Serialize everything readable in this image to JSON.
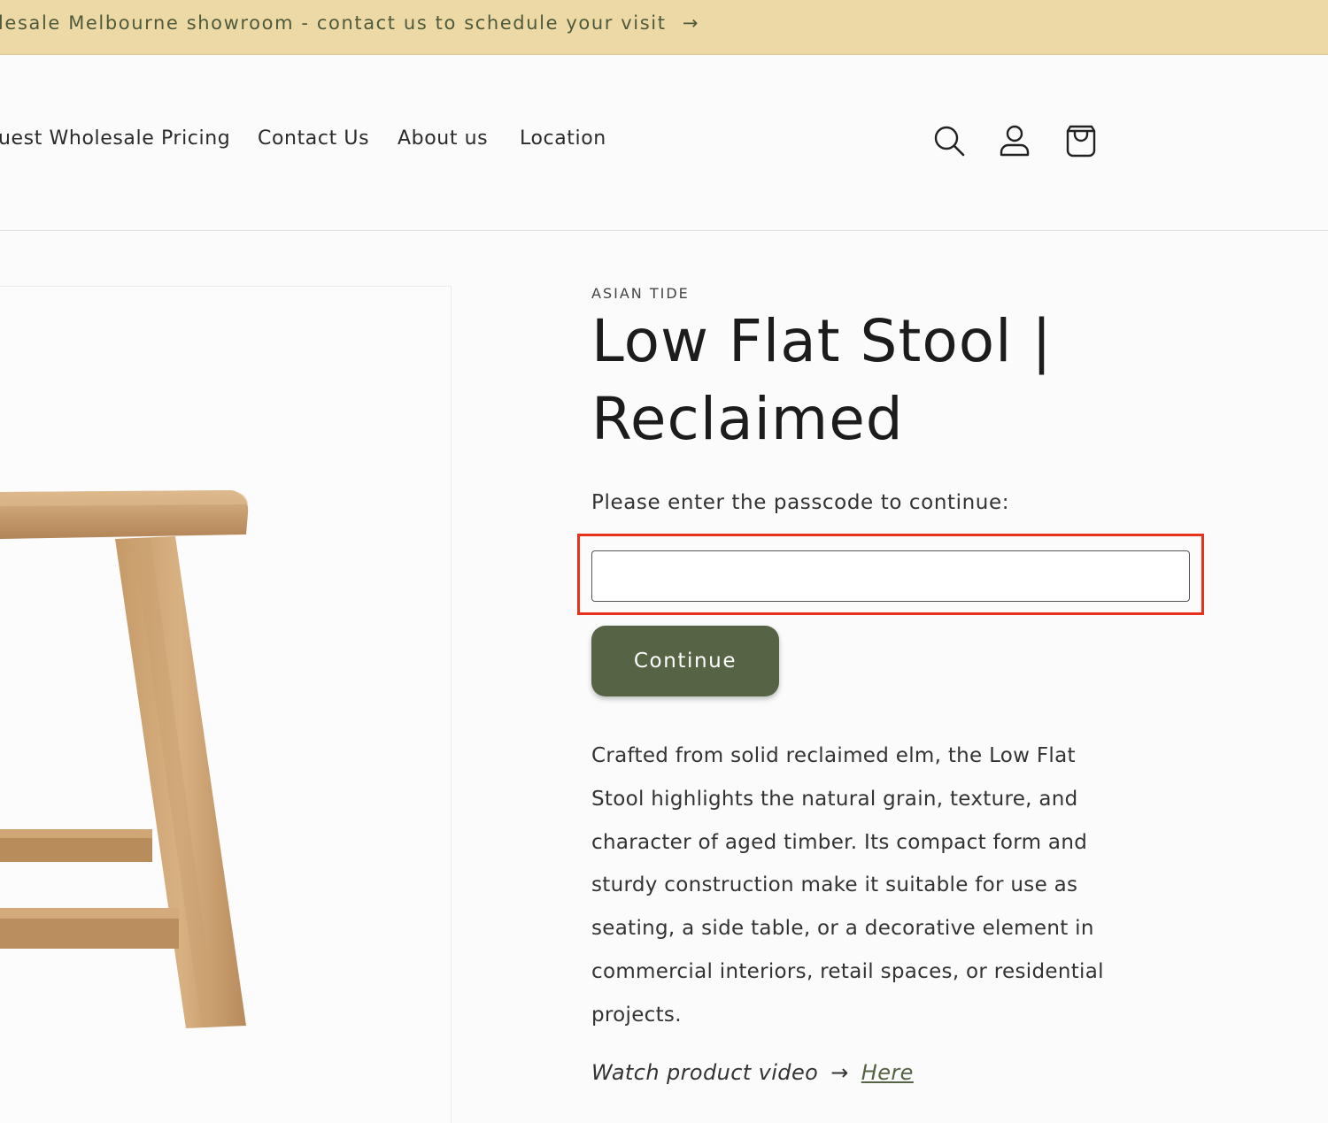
{
  "announcement": {
    "text": "lesale Melbourne showroom - contact us to schedule your visit",
    "arrow": "→"
  },
  "nav": {
    "items": [
      "uest Wholesale Pricing",
      "Contact Us",
      "About us",
      "Location"
    ],
    "icons": [
      "search-icon",
      "account-icon",
      "cart-icon"
    ]
  },
  "product": {
    "vendor": "ASIAN TIDE",
    "title": "Low Flat Stool | Reclaimed",
    "passcode_label": "Please enter the passcode to continue:",
    "passcode_value": "",
    "continue_label": "Continue",
    "description": "Crafted from solid reclaimed elm, the Low Flat Stool highlights the natural grain, texture, and character of aged timber. Its compact form and sturdy construction make it suitable for use as seating, a side table, or a decorative element in commercial interiors, retail spaces, or residential projects.",
    "video_prefix": "Watch product video",
    "video_arrow": "→",
    "video_link": "Here"
  },
  "colors": {
    "announcement_bg": "#ecd9a5",
    "button_bg": "#566344",
    "highlight": "#e8321c"
  }
}
